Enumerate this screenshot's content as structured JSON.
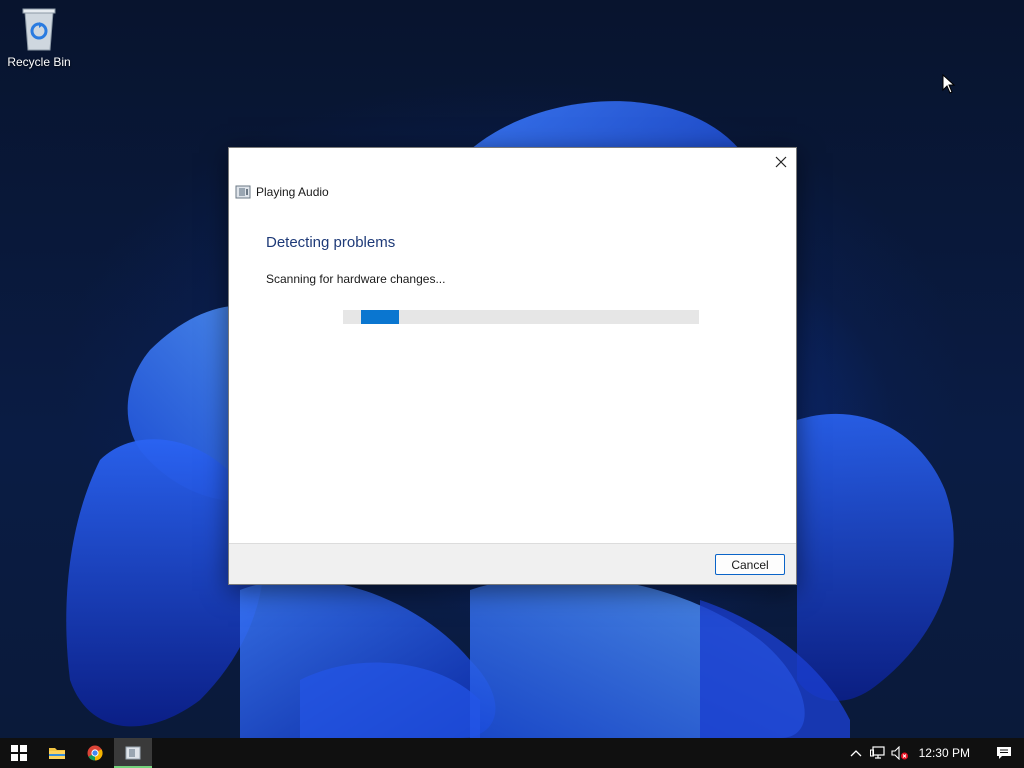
{
  "desktop": {
    "icons": [
      {
        "label": "Recycle Bin",
        "icon": "recycle-bin-icon"
      }
    ]
  },
  "dialog": {
    "title": "Playing Audio",
    "heading": "Detecting problems",
    "status": "Scanning for hardware changes...",
    "progress": {
      "state": "indeterminate"
    },
    "cancel_label": "Cancel",
    "close_icon": "close-icon"
  },
  "taskbar": {
    "apps": [
      {
        "name": "start",
        "icon": "windows-logo-icon"
      },
      {
        "name": "file-explorer",
        "icon": "folder-icon"
      },
      {
        "name": "chrome",
        "icon": "chrome-icon"
      },
      {
        "name": "troubleshooter",
        "icon": "troubleshooter-icon",
        "active": true
      }
    ],
    "tray": {
      "icons": [
        "chevron-up-icon",
        "network-icon",
        "volume-muted-icon"
      ],
      "time": "12:30 PM"
    }
  },
  "colors": {
    "accent": "#0a76d0",
    "heading": "#1e3a78",
    "taskbar": "#101010",
    "active_indicator": "#74d27c"
  }
}
